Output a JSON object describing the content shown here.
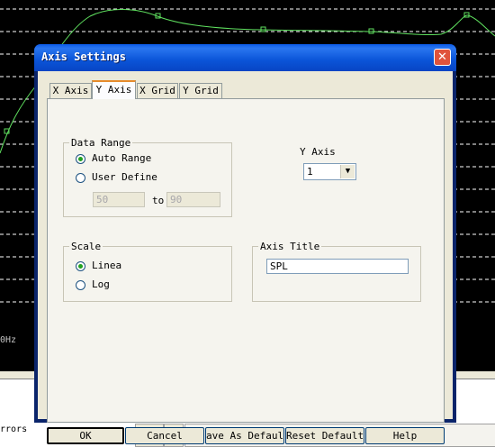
{
  "background_app": {
    "freq_label": "0Hz",
    "errors_label": "rrors"
  },
  "dialog": {
    "title": "Axis Settings",
    "close_symbol": "✕",
    "tabs": [
      {
        "label": "X Axis",
        "selected": false
      },
      {
        "label": "Y Axis",
        "selected": true
      },
      {
        "label": "X Grid",
        "selected": false
      },
      {
        "label": "Y Grid",
        "selected": false
      }
    ],
    "data_range": {
      "group_label": "Data Range",
      "auto_range_label": "Auto Range",
      "user_defined_label": "User Define",
      "selected": "auto",
      "min_value": "50",
      "to_label": "to",
      "max_value": "90"
    },
    "y_axis": {
      "label": "Y Axis",
      "selected_value": "1"
    },
    "scale": {
      "group_label": "Scale",
      "linear_label": "Linea",
      "log_label": "Log",
      "selected": "linear"
    },
    "axis_title": {
      "group_label": "Axis Title",
      "value": "SPL"
    },
    "buttons": {
      "ok": "OK",
      "cancel": "Cancel",
      "save_defaults": "ave As Defaul",
      "reset_defaults": "Reset Defaults",
      "help": "Help"
    }
  }
}
